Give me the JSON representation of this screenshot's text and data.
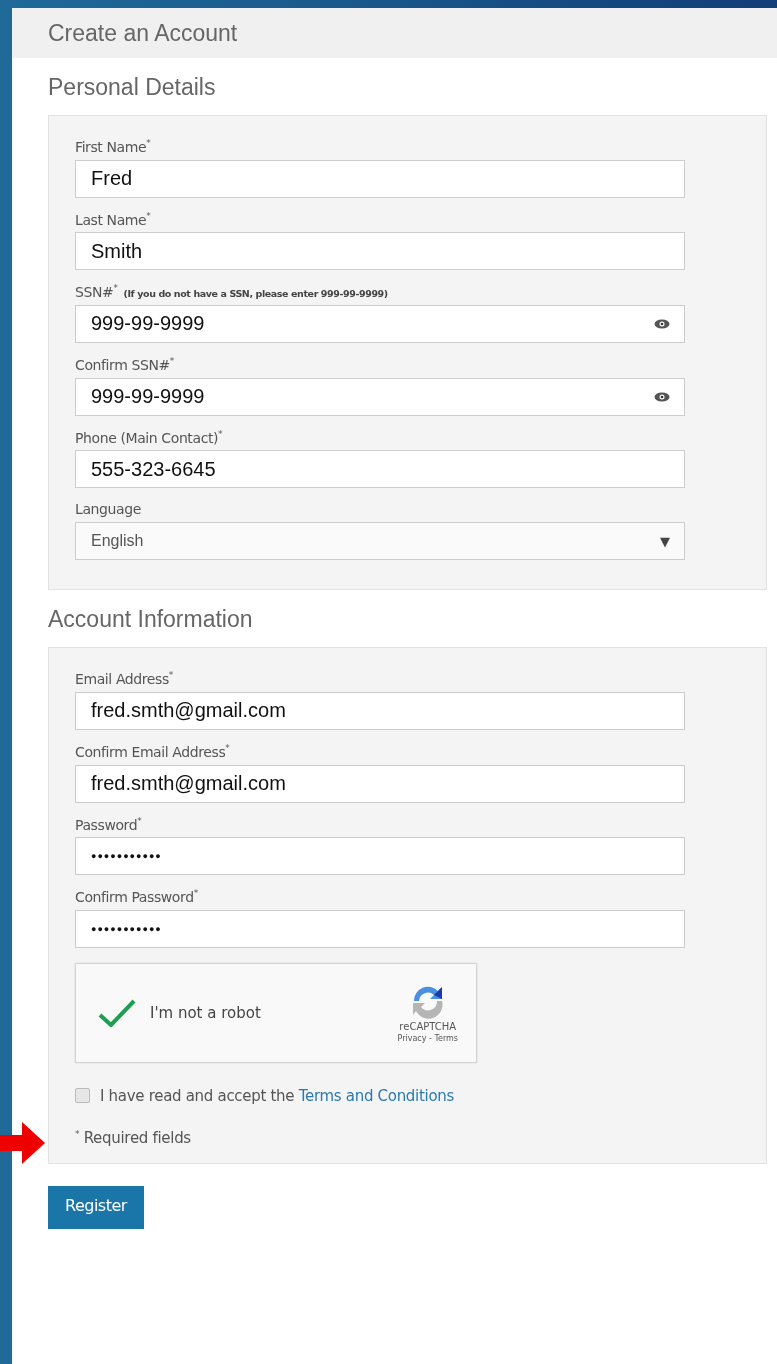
{
  "page": {
    "title": "Create an Account"
  },
  "sections": [
    {
      "heading": "Personal Details",
      "fields": [
        {
          "kind": "text",
          "label": "First Name$^{*}$",
          "value": "Fred"
        },
        {
          "kind": "text",
          "label": "Last Name$^{*}$",
          "value": "Smith"
        },
        {
          "kind": "secret",
          "label": "SSN#$^{*}$",
          "hint": "(If you do not have a SSN, please enter 999-99-9999)",
          "value": "999-99-9999"
        },
        {
          "kind": "secret",
          "label": "Confirm SSN#$^{*}$",
          "value": "999-99-9999"
        },
        {
          "kind": "text",
          "label": "Phone (Main Contact)$^{*}$",
          "value": "555-323-6645"
        },
        {
          "kind": "select",
          "label": "Language",
          "value": "English",
          "caret": "▼"
        }
      ]
    },
    {
      "heading": "Account Information",
      "fields": [
        {
          "kind": "text",
          "label": "Email Address$^{*}$",
          "value": "fred.smth@gmail.com"
        },
        {
          "kind": "text",
          "label": "Confirm Email Address$^{*}$",
          "value": "fred.smth@gmail.com"
        },
        {
          "kind": "password",
          "label": "Password$^{*}$",
          "value": "●●●●●●●●●●●"
        },
        {
          "kind": "password",
          "label": "Confirm Password$^{*}$",
          "value": "●●●●●●●●●●●"
        }
      ],
      "captcha": {
        "label": "I'm not a robot",
        "checked": true,
        "brand": "reCAPTCHA",
        "links": "Privacy - Terms"
      },
      "terms": {
        "checked": false,
        "text": "I have read and accept the",
        "link": "Terms and Conditions"
      },
      "note": "$^{*}$ Required fields"
    }
  ],
  "button": "Register"
}
